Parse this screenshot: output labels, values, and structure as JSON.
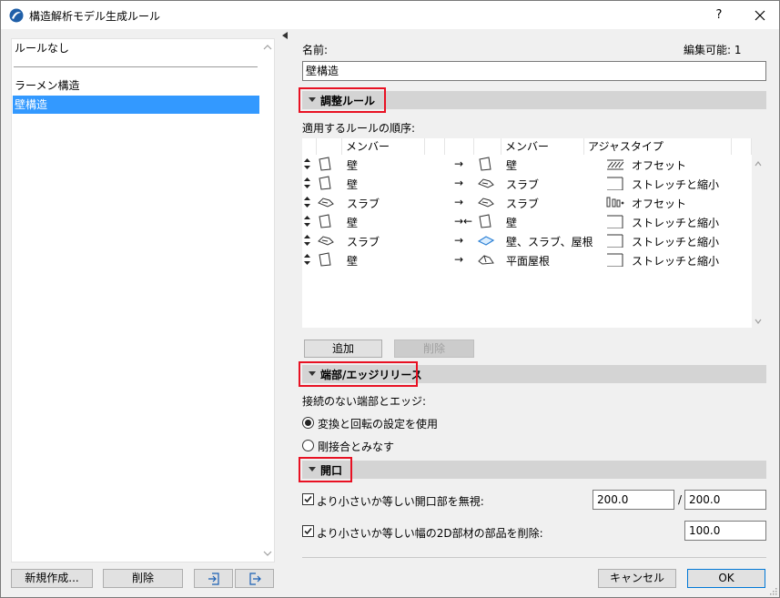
{
  "window": {
    "title": "構造解析モデル生成ルール",
    "help": "?"
  },
  "left": {
    "items": [
      "ルールなし",
      "ラーメン構造",
      "壁構造"
    ],
    "new_button": "新規作成...",
    "delete_button": "削除"
  },
  "right": {
    "name_label": "名前:",
    "editable_label": "編集可能: 1",
    "name_value": "壁構造",
    "section1": "調整ルール",
    "order_label": "適用するルールの順序:",
    "headers": [
      "メンバー",
      "メンバー",
      "アジャスタイプ"
    ],
    "rows": [
      {
        "m1": "壁",
        "m1_icon": "wall-icon",
        "arrow": "→",
        "m2": "壁",
        "m2_icon": "wall-icon",
        "type": "オフセット",
        "type_icon": "hatch-offset-icon"
      },
      {
        "m1": "壁",
        "m1_icon": "wall-icon",
        "arrow": "→",
        "m2": "スラブ",
        "m2_icon": "slab-icon",
        "type": "ストレッチと縮小",
        "type_icon": "stretch-icon"
      },
      {
        "m1": "スラブ",
        "m1_icon": "slab-icon",
        "arrow": "→",
        "m2": "スラブ",
        "m2_icon": "slab-icon",
        "type": "オフセット",
        "type_icon": "bars-offset-icon"
      },
      {
        "m1": "壁",
        "m1_icon": "wall-icon",
        "arrow": "→←",
        "m2": "壁",
        "m2_icon": "wall-icon",
        "type": "ストレッチと縮小",
        "type_icon": "stretch-icon"
      },
      {
        "m1": "スラブ",
        "m1_icon": "slab-icon",
        "arrow": "→",
        "m2": "壁、スラブ、屋根",
        "m2_icon": "multi-blue-icon",
        "type": "ストレッチと縮小",
        "type_icon": "stretch-icon"
      },
      {
        "m1": "壁",
        "m1_icon": "wall-icon",
        "arrow": "→",
        "m2": "平面屋根",
        "m2_icon": "roof-icon",
        "type": "ストレッチと縮小",
        "type_icon": "stretch-icon"
      }
    ],
    "add_button": "追加",
    "remove_button": "削除",
    "section2": "端部/エッジリリース",
    "free_ends_label": "接続のない端部とエッジ:",
    "radio1": "変換と回転の設定を使用",
    "radio1_checked": true,
    "radio2": "剛接合とみなす",
    "radio2_checked": false,
    "section3": "開口",
    "check1": "より小さいか等しい開口部を無視:",
    "check1_checked": true,
    "check1_value_a": "200.0",
    "check1_sep": "/",
    "check1_value_b": "200.0",
    "check2": "より小さいか等しい幅の2D部材の部品を削除:",
    "check2_checked": true,
    "check2_value": "100.0",
    "cancel_button": "キャンセル",
    "ok_button": "OK"
  },
  "colors": {
    "selection": "#3399ff",
    "highlight": "#e81123",
    "section_bar": "#d4d4d4"
  }
}
